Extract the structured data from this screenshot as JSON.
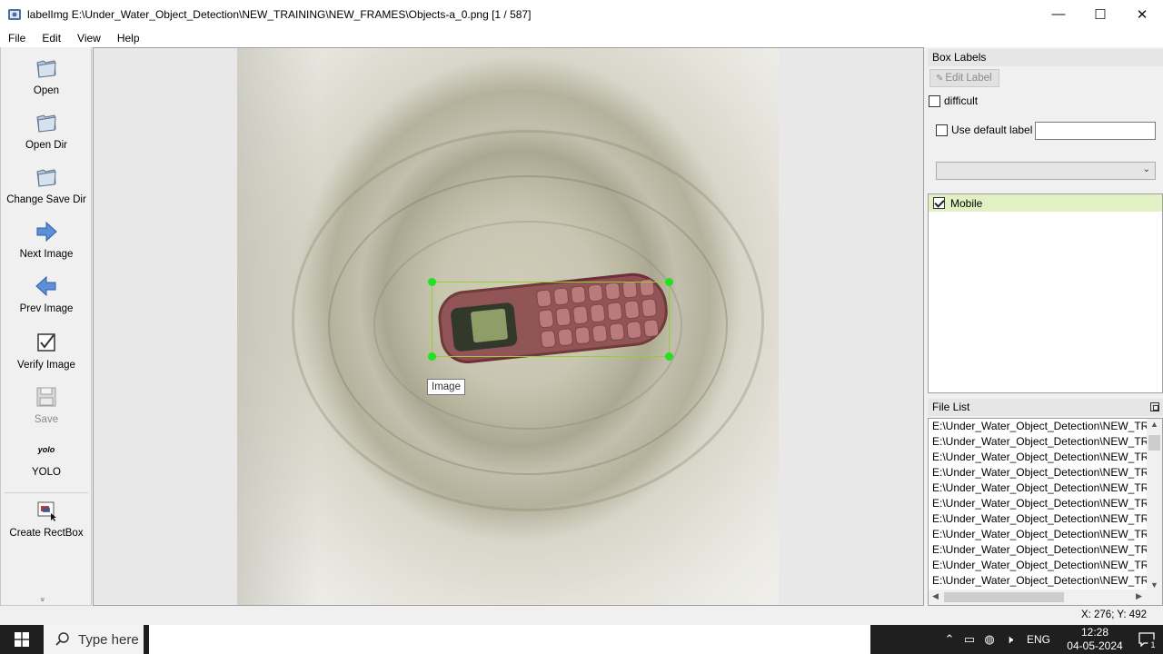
{
  "window": {
    "title": "labelImg E:\\Under_Water_Object_Detection\\NEW_TRAINING\\NEW_FRAMES\\Objects-a_0.png [1 / 587]",
    "minimize": "—",
    "maximize": "☐",
    "close": "✕"
  },
  "menu": [
    "File",
    "Edit",
    "View",
    "Help"
  ],
  "toolbar": {
    "open": "Open",
    "open_dir": "Open Dir",
    "change_save_dir": "Change Save Dir",
    "next_image": "Next Image",
    "prev_image": "Prev Image",
    "verify_image": "Verify Image",
    "save": "Save",
    "yolo_icon_text": "yolo",
    "yolo": "YOLO",
    "create_rectbox": "Create RectBox",
    "more": "»"
  },
  "canvas": {
    "tooltip": "Image",
    "box_color": "#9acd32",
    "handle_color": "#22e022"
  },
  "box_labels": {
    "title": "Box Labels",
    "edit_label": "Edit Label",
    "difficult": "difficult",
    "use_default_label": "Use default label",
    "default_label_value": "",
    "labels": [
      {
        "name": "Mobile",
        "checked": true
      }
    ]
  },
  "file_list": {
    "title": "File List",
    "items": [
      "E:\\Under_Water_Object_Detection\\NEW_TRA",
      "E:\\Under_Water_Object_Detection\\NEW_TRA",
      "E:\\Under_Water_Object_Detection\\NEW_TRA",
      "E:\\Under_Water_Object_Detection\\NEW_TRA",
      "E:\\Under_Water_Object_Detection\\NEW_TRA",
      "E:\\Under_Water_Object_Detection\\NEW_TRA",
      "E:\\Under_Water_Object_Detection\\NEW_TRA",
      "E:\\Under_Water_Object_Detection\\NEW_TRA",
      "E:\\Under_Water_Object_Detection\\NEW_TRA",
      "E:\\Under_Water_Object_Detection\\NEW_TRA",
      "E:\\Under_Water_Object_Detection\\NEW_TRA"
    ]
  },
  "status": {
    "coords": "X: 276; Y: 492"
  },
  "taskbar": {
    "search_placeholder": "Type here",
    "language": "ENG",
    "time": "12:28",
    "date": "04-05-2024",
    "notification_count": "1"
  }
}
